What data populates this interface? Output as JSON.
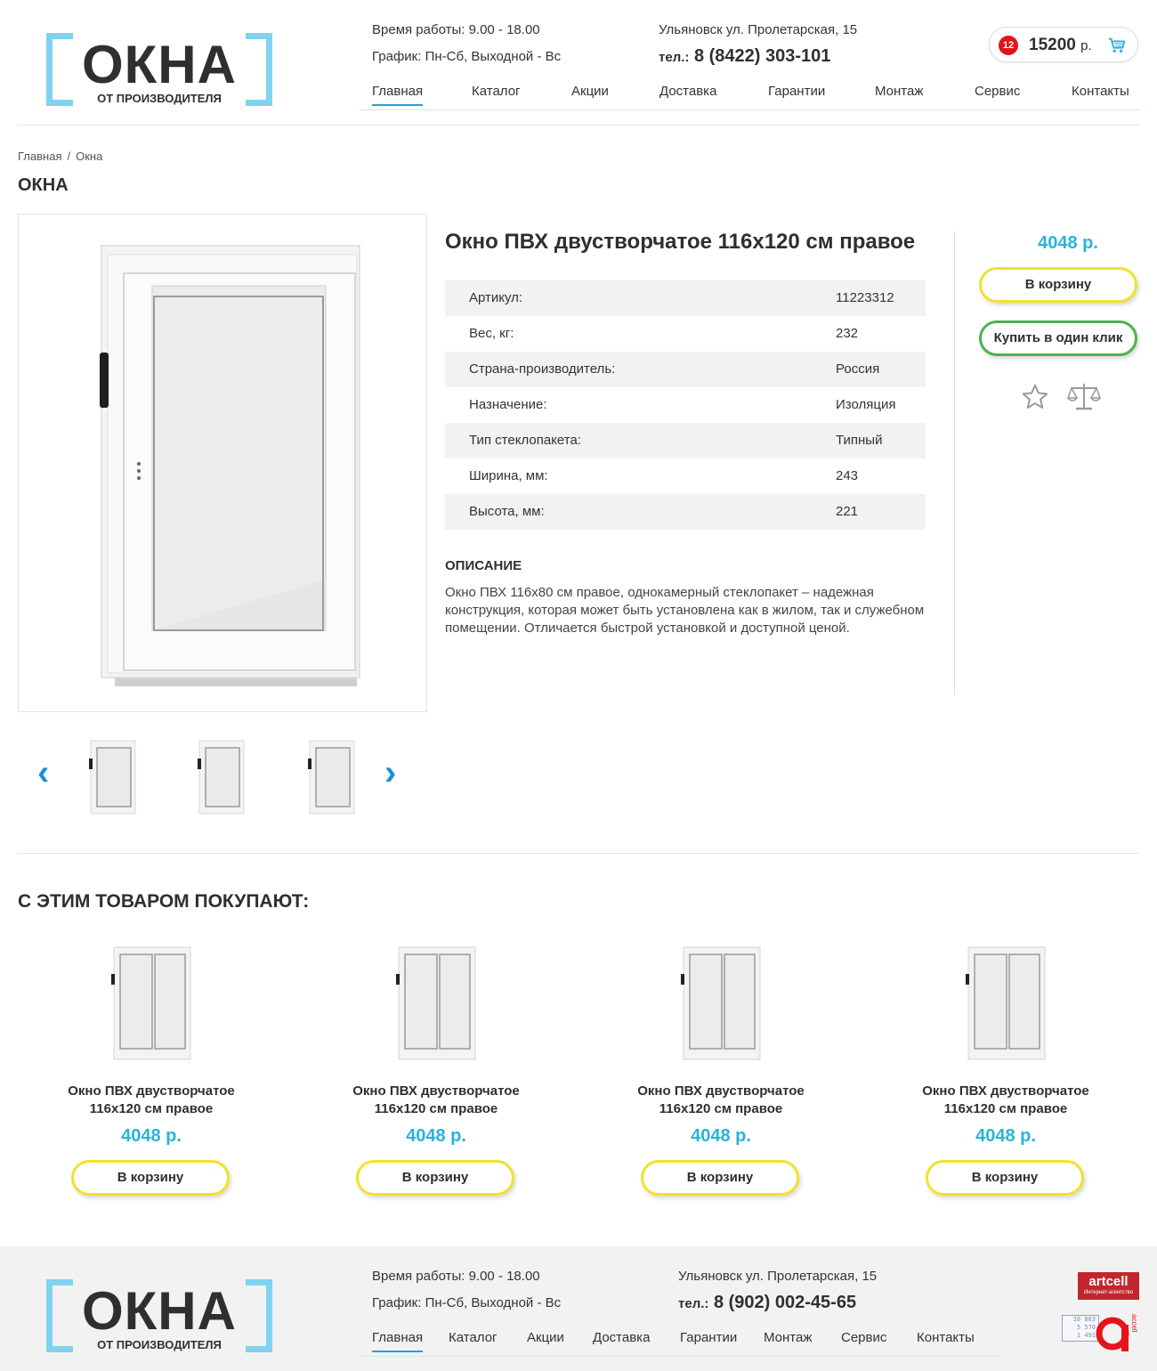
{
  "header": {
    "logo": {
      "big": "ОКНА",
      "small": "ОТ ПРОИЗВОДИТЕЛЯ"
    },
    "hours": "Время работы: 9.00 - 18.00",
    "schedule": "График: Пн-Сб, Выходной - Вс",
    "address": "Ульяновск ул. Пролетарская, 15",
    "phone_label": "тел.:",
    "phone": "8 (8422) 303-101",
    "nav": [
      "Главная",
      "Каталог",
      "Акции",
      "Доставка",
      "Гарантии",
      "Монтаж",
      "Сервис",
      "Контакты"
    ],
    "cart": {
      "count": "12",
      "sum": "15200",
      "currency": "р.",
      "icon": "cart-icon"
    }
  },
  "breadcrumb": {
    "home": "Главная",
    "sep": "/",
    "current": "Окна"
  },
  "page_title": "ОКНА",
  "product": {
    "title": "Окно ПВХ двустворчатое 116х120 см правое",
    "price": "4048 р.",
    "add_to_cart": "В корзину",
    "one_click": "Купить в один клик",
    "specs": [
      {
        "k": "Артикул:",
        "v": "11223312"
      },
      {
        "k": "Вес, кг:",
        "v": "232"
      },
      {
        "k": "Страна-производитель:",
        "v": "Россия"
      },
      {
        "k": "Назначение:",
        "v": "Изоляция"
      },
      {
        "k": "Тип стеклопакета:",
        "v": "Типный"
      },
      {
        "k": "Ширина, мм:",
        "v": "243"
      },
      {
        "k": "Высота, мм:",
        "v": "221"
      }
    ],
    "desc_title": "ОПИСАНИЕ",
    "desc": "Окно ПВХ 116х80 см правое, однокамерный стеклопакет – надежная конструкция, которая может быть установлена как в жилом, так и служебном помещении. Отличается быстрой установкой и доступной ценой."
  },
  "related": {
    "title": "С ЭТИМ ТОВАРОМ ПОКУПАЮТ:",
    "items": [
      {
        "name1": "Окно ПВХ двустворчатое",
        "name2": "116х120 см правое",
        "price": "4048 р.",
        "btn": "В корзину"
      },
      {
        "name1": "Окно ПВХ двустворчатое",
        "name2": "116х120 см правое",
        "price": "4048 р.",
        "btn": "В корзину"
      },
      {
        "name1": "Окно ПВХ двустворчатое",
        "name2": "116х120 см правое",
        "price": "4048 р.",
        "btn": "В корзину"
      },
      {
        "name1": "Окно ПВХ двустворчатое",
        "name2": "116х120 см правое",
        "price": "4048 р.",
        "btn": "В корзину"
      }
    ]
  },
  "footer": {
    "hours": "Время работы: 9.00 - 18.00",
    "schedule": "График: Пн-Сб, Выходной - Вс",
    "address": "Ульяновск ул. Пролетарская, 15",
    "phone_label": "тел.:",
    "phone": "8 (902) 002-45-65",
    "nav": [
      "Главная",
      "Каталог",
      "Акции",
      "Доставка",
      "Гарантии",
      "Монтаж",
      "Сервис",
      "Контакты"
    ],
    "artcell": "artcell",
    "artcell_sub": "Интернет-агентство",
    "counter": [
      "10 803",
      "5 570",
      "1 491"
    ],
    "accell": "accell"
  },
  "colors": {
    "accent": "#29b3da",
    "logo_bracket": "#7fd3ef",
    "btn_yellow": "#f1e22b",
    "btn_green": "#4bb34f",
    "badge": "#e3141b"
  }
}
